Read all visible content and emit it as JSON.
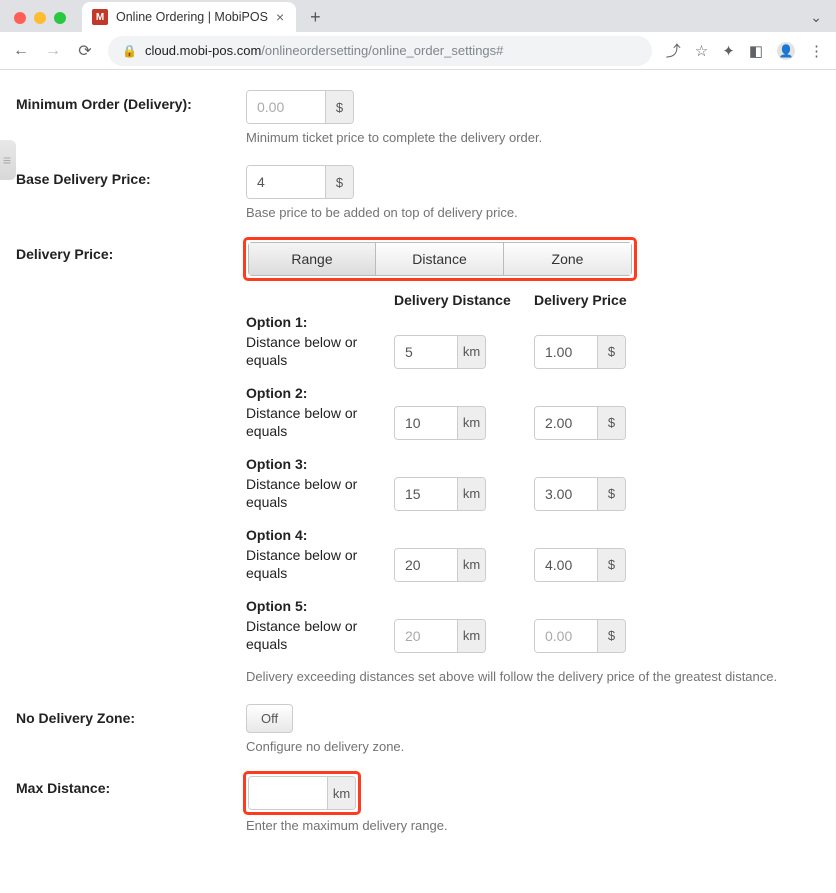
{
  "browser": {
    "tab_title": "Online Ordering | MobiPOS",
    "favicon_letter": "M",
    "url_host": "cloud.mobi-pos.com",
    "url_path": "/onlineordersetting/online_order_settings#"
  },
  "labels": {
    "minimum_order": "Minimum Order (Delivery):",
    "minimum_order_help": "Minimum ticket price to complete the delivery order.",
    "base_price": "Base Delivery Price:",
    "base_price_help": "Base price to be added on top of delivery price.",
    "delivery_price": "Delivery Price:",
    "no_delivery_zone": "No Delivery Zone:",
    "no_delivery_zone_help": "Configure no delivery zone.",
    "max_distance": "Max Distance:",
    "max_distance_help": "Enter the maximum delivery range.",
    "dist_col": "Delivery Distance",
    "price_col": "Delivery Price",
    "distance_sub": "Distance below or equals",
    "exceeding_help": "Delivery exceeding distances set above will follow the delivery price of the greatest distance."
  },
  "segments": {
    "range": "Range",
    "distance": "Distance",
    "zone": "Zone"
  },
  "units": {
    "currency": "$",
    "km": "km"
  },
  "values": {
    "minimum_order_placeholder": "0.00",
    "base_price": "4",
    "max_distance": "",
    "toggle_off": "Off"
  },
  "options": [
    {
      "title": "Option 1:",
      "distance": "5",
      "price": "1.00",
      "dist_placeholder": "",
      "price_placeholder": ""
    },
    {
      "title": "Option 2:",
      "distance": "10",
      "price": "2.00",
      "dist_placeholder": "",
      "price_placeholder": ""
    },
    {
      "title": "Option 3:",
      "distance": "15",
      "price": "3.00",
      "dist_placeholder": "",
      "price_placeholder": ""
    },
    {
      "title": "Option 4:",
      "distance": "20",
      "price": "4.00",
      "dist_placeholder": "",
      "price_placeholder": ""
    },
    {
      "title": "Option 5:",
      "distance": "",
      "price": "",
      "dist_placeholder": "20",
      "price_placeholder": "0.00"
    }
  ]
}
